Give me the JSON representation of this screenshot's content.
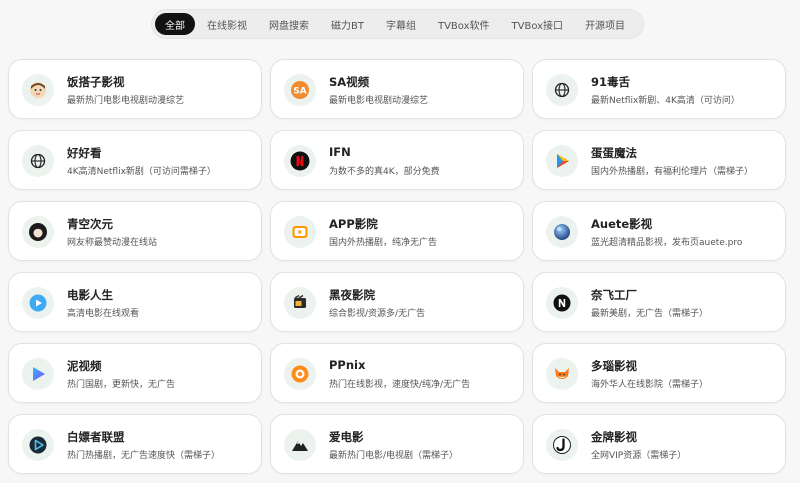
{
  "tabs": [
    {
      "label": "全部",
      "active": true
    },
    {
      "label": "在线影视",
      "active": false
    },
    {
      "label": "网盘搜索",
      "active": false
    },
    {
      "label": "磁力BT",
      "active": false
    },
    {
      "label": "字幕组",
      "active": false
    },
    {
      "label": "TVBox软件",
      "active": false
    },
    {
      "label": "TVBox接口",
      "active": false
    },
    {
      "label": "开源项目",
      "active": false
    }
  ],
  "cards": [
    {
      "title": "饭搭子影视",
      "desc": "最新热门电影电视剧动漫综艺",
      "icon": "mascot-icon"
    },
    {
      "title": "SA视频",
      "desc": "最新电影电视剧动漫综艺",
      "icon": "sa-logo-icon"
    },
    {
      "title": "91毒舌",
      "desc": "最新Netflix新剧、4K高清（可访问）",
      "icon": "globe-icon"
    },
    {
      "title": "好好看",
      "desc": "4K高清Netflix新剧（可访问需梯子）",
      "icon": "globe-icon"
    },
    {
      "title": "IFN",
      "desc": "为数不多的真4K，部分免费",
      "icon": "netflix-n-icon"
    },
    {
      "title": "蛋蛋魔法",
      "desc": "国内外热播剧，有福利伦理片（需梯子）",
      "icon": "play-triangle-icon"
    },
    {
      "title": "青空次元",
      "desc": "网友称最赞动漫在线站",
      "icon": "anime-avatar-icon"
    },
    {
      "title": "APP影院",
      "desc": "国内外热播剧，纯净无广告",
      "icon": "tv-play-icon"
    },
    {
      "title": "Auete影视",
      "desc": "蓝光超清精品影视，发布页auete.pro",
      "icon": "planet-icon"
    },
    {
      "title": "电影人生",
      "desc": "高清电影在线观看",
      "icon": "play-circle-icon"
    },
    {
      "title": "黑夜影院",
      "desc": "综合影视/资源多/无广告",
      "icon": "film-box-icon"
    },
    {
      "title": "奈飞工厂",
      "desc": "最新美剧，无广告（需梯子）",
      "icon": "n-circle-icon"
    },
    {
      "title": "泥视频",
      "desc": "热门国剧，更新快，无广告",
      "icon": "gradient-play-icon"
    },
    {
      "title": "PPnix",
      "desc": "热门在线影视，速度快/纯净/无广告",
      "icon": "p-circle-icon"
    },
    {
      "title": "多瑙影视",
      "desc": "海外华人在线影院（需梯子）",
      "icon": "fox-icon"
    },
    {
      "title": "白嫖者联盟",
      "desc": "热门热播剧，无广告速度快（需梯子）",
      "icon": "play-outline-icon"
    },
    {
      "title": "爱电影",
      "desc": "最新热门电影/电视剧（需梯子）",
      "icon": "mountain-icon"
    },
    {
      "title": "金牌影视",
      "desc": "全网VIP资源（需梯子）",
      "icon": "j-logo-icon"
    }
  ]
}
